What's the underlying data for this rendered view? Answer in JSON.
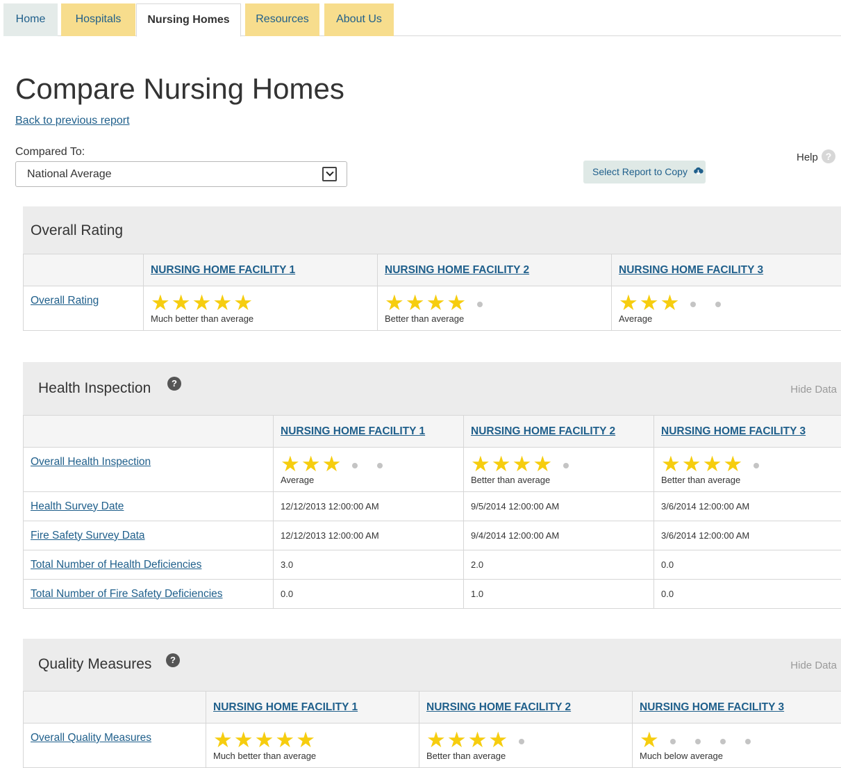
{
  "tabs": [
    {
      "label": "Home"
    },
    {
      "label": "Hospitals"
    },
    {
      "label": "Nursing Homes"
    },
    {
      "label": "Resources"
    },
    {
      "label": "About Us"
    }
  ],
  "page": {
    "title": "Compare Nursing Homes",
    "back_link": "Back to previous report",
    "compared_to_label": "Compared To:",
    "compared_to_value": "National Average",
    "select_copy_label": "Select Report to Copy",
    "help_label": "Help",
    "help_icon_glyph": "?"
  },
  "colors": {
    "star_fill": "#f6cd0f",
    "star_empty_dot": "#c4c4c4",
    "link": "#1f5f8b",
    "tab_yellow": "#f7dd8d",
    "tab_home": "#e4ebe9",
    "section_header_bg": "#ececec"
  },
  "icons": {
    "select_arrow": "chevron-down-icon",
    "copy": "cloud-download-icon",
    "help": "question-circle-icon"
  },
  "facilities": [
    "NURSING HOME FACILITY 1",
    "NURSING HOME FACILITY 2",
    "NURSING HOME FACILITY 3"
  ],
  "overall": {
    "title": "Overall Rating",
    "row_label": "Overall Rating",
    "ratings": [
      {
        "stars": 5,
        "text": "Much better than average"
      },
      {
        "stars": 4,
        "text": "Better than average"
      },
      {
        "stars": 3,
        "text": "Average"
      }
    ]
  },
  "health": {
    "title": "Health Inspection",
    "hide_label": "Hide Data",
    "rating_label": "Overall Health Inspection",
    "ratings": [
      {
        "stars": 3,
        "text": "Average"
      },
      {
        "stars": 4,
        "text": "Better than average"
      },
      {
        "stars": 4,
        "text": "Better than average"
      }
    ],
    "rows": [
      {
        "label": "Health Survey Date",
        "values": [
          "12/12/2013 12:00:00 AM",
          "9/5/2014 12:00:00 AM",
          "3/6/2014 12:00:00 AM"
        ]
      },
      {
        "label": "Fire Safety Survey Data",
        "values": [
          "12/12/2013 12:00:00 AM",
          "9/4/2014 12:00:00 AM",
          "3/6/2014 12:00:00 AM"
        ]
      },
      {
        "label": "Total Number of Health Deficiencies",
        "values": [
          "3.0",
          "2.0",
          "0.0"
        ]
      },
      {
        "label": "Total Number of Fire Safety Deficiencies",
        "values": [
          "0.0",
          "1.0",
          "0.0"
        ]
      }
    ]
  },
  "quality": {
    "title": "Quality Measures",
    "hide_label": "Hide Data",
    "rating_label": "Overall Quality Measures",
    "ratings": [
      {
        "stars": 5,
        "text": "Much better than average"
      },
      {
        "stars": 4,
        "text": "Better than average"
      },
      {
        "stars": 1,
        "text": "Much below average"
      }
    ]
  }
}
